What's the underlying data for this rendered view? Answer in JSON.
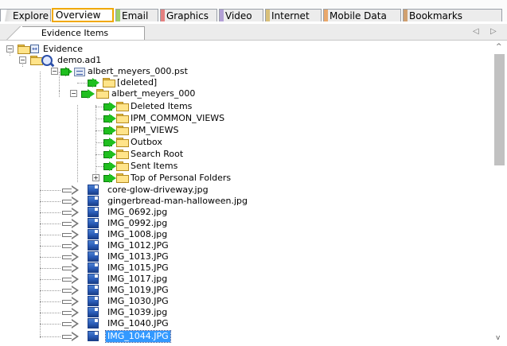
{
  "top_tabs": [
    {
      "label": "Explore",
      "tint": "#dcdcdc",
      "active": false
    },
    {
      "label": "Overview",
      "tint": "#f0a800",
      "active": true
    },
    {
      "label": "Email",
      "tint": "#9ccf6a",
      "active": false
    },
    {
      "label": "Graphics",
      "tint": "#e48080",
      "active": false
    },
    {
      "label": "Video",
      "tint": "#b3a0d6",
      "active": false
    },
    {
      "label": "Internet",
      "tint": "#d8c07a",
      "active": false
    },
    {
      "label": "Mobile Data",
      "tint": "#e9a86c",
      "active": false
    },
    {
      "label": "Bookmarks",
      "tint": "#d0a070",
      "active": false
    }
  ],
  "panel": {
    "tab_label": "Evidence Items",
    "nav_left": "◁",
    "nav_right": "▷"
  },
  "tree": {
    "root": "Evidence",
    "image": "demo.ad1",
    "pst": "albert_meyers_000.pst",
    "deleted": "[deleted]",
    "mailbox": "albert_meyers_000",
    "folders": [
      "Deleted Items",
      "IPM_COMMON_VIEWS",
      "IPM_VIEWS",
      "Outbox",
      "Search Root",
      "Sent Items",
      "Top of Personal Folders"
    ],
    "files": [
      "core-glow-driveway.jpg",
      "gingerbread-man-halloween.jpg",
      "IMG_0692.jpg",
      "IMG_0992.jpg",
      "IMG_1008.jpg",
      "IMG_1012.JPG",
      "IMG_1013.JPG",
      "IMG_1015.JPG",
      "IMG_1017.jpg",
      "IMG_1019.JPG",
      "IMG_1030.JPG",
      "IMG_1039.jpg",
      "IMG_1040.JPG",
      "IMG_1044.JPG"
    ],
    "selected_file": "IMG_1044.JPG"
  },
  "scrollbar": {
    "up": "^",
    "down": "v"
  }
}
